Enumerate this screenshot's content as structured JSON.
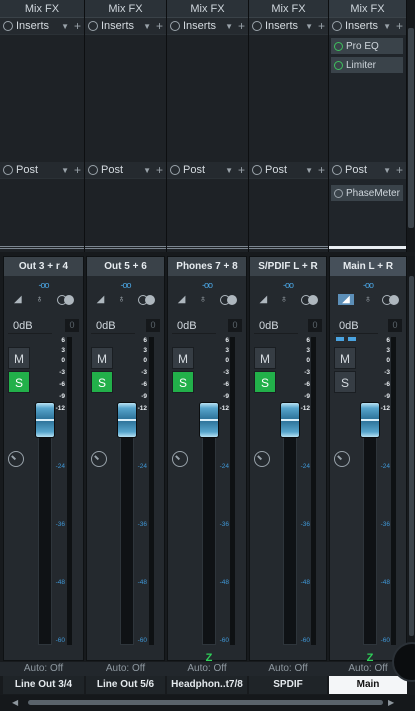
{
  "fx_panel": {
    "columns": [
      {
        "mixfx": "Mix FX",
        "inserts": "Inserts",
        "post": "Post",
        "insert_plugins": [],
        "post_plugins": []
      },
      {
        "mixfx": "Mix FX",
        "inserts": "Inserts",
        "post": "Post",
        "insert_plugins": [],
        "post_plugins": []
      },
      {
        "mixfx": "Mix FX",
        "inserts": "Inserts",
        "post": "Post",
        "insert_plugins": [],
        "post_plugins": []
      },
      {
        "mixfx": "Mix FX",
        "inserts": "Inserts",
        "post": "Post",
        "insert_plugins": [],
        "post_plugins": []
      },
      {
        "mixfx": "Mix FX",
        "inserts": "Inserts",
        "post": "Post",
        "insert_plugins": [
          "Pro EQ",
          "Limiter"
        ],
        "post_plugins": [
          "PhaseMeter"
        ]
      }
    ]
  },
  "strips": [
    {
      "name": "Out 3 + r 4",
      "pan": "-oo",
      "volume": "0dB",
      "peak": "0",
      "mute": "M",
      "solo": "S",
      "solo_on": true,
      "automation": "Auto: Off",
      "output": "Line Out 3/4",
      "z": "",
      "fader_db": 0
    },
    {
      "name": "Out 5 + 6",
      "pan": "-oo",
      "volume": "0dB",
      "peak": "0",
      "mute": "M",
      "solo": "S",
      "solo_on": true,
      "automation": "Auto: Off",
      "output": "Line Out 5/6",
      "z": "",
      "fader_db": 0
    },
    {
      "name": "Phones 7 + 8",
      "pan": "-oo",
      "volume": "0dB",
      "peak": "0",
      "mute": "M",
      "solo": "S",
      "solo_on": true,
      "automation": "Auto: Off",
      "output": "Headphon..t7/8",
      "z": "Z",
      "fader_db": 0
    },
    {
      "name": "S/PDIF L + R",
      "pan": "-oo",
      "volume": "0dB",
      "peak": "0",
      "mute": "M",
      "solo": "S",
      "solo_on": true,
      "automation": "Auto: Off",
      "output": "SPDIF",
      "z": "",
      "fader_db": 0
    },
    {
      "name": "Main L + R",
      "pan": "-oo",
      "volume": "0dB",
      "peak": "0",
      "mute": "M",
      "solo": "S",
      "solo_on": false,
      "automation": "Auto: Off",
      "output": "Main",
      "z": "Z",
      "fader_db": 0
    }
  ],
  "meter_scale": [
    "6",
    "3",
    "0",
    "-3",
    "-6",
    "-9",
    "-12",
    "-24",
    "-36",
    "-48",
    "-60"
  ],
  "icons": {
    "power": "power-icon",
    "dropdown": "chevron-down-icon",
    "add": "plus-icon",
    "speaker": "speaker-icon",
    "mic": "microphone-icon",
    "link": "link-icon",
    "knob": "knob-icon"
  },
  "colors": {
    "solo_on": "#22b04a",
    "fader": "#57a5cc",
    "z_mark": "#2fcf59",
    "pan": "#4aa3e0",
    "selected_output": "#f4f6f8"
  }
}
